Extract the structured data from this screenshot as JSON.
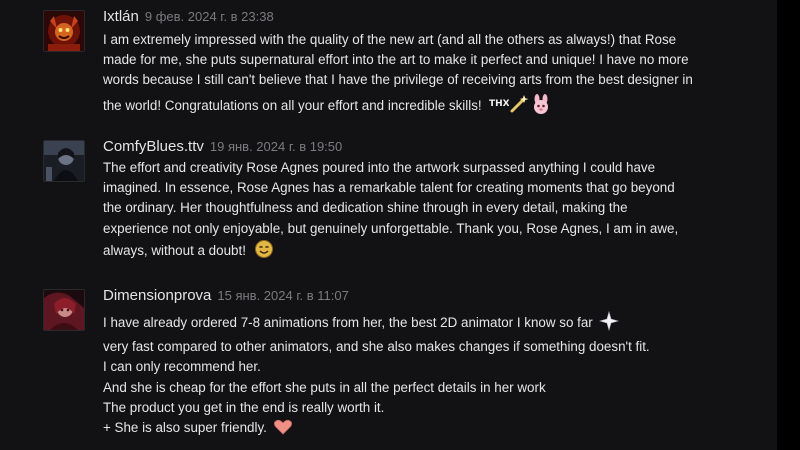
{
  "comments": [
    {
      "author": "Ixtlán",
      "date": "9 фев. 2024 г. в 23:38",
      "lines": [
        "I am extremely impressed with the quality of the new art (and all the others as always!) that Rose",
        "made for me, she puts supernatural effort into the art to make it perfect and unique! I have no more",
        "words because I still can't believe that I have the privilege of receiving arts from the best designer in",
        "the world! Congratulations on all your effort and incredible skills!"
      ],
      "emoji_text": "THX",
      "emoticons": [
        "thx-emoticon",
        "magic-wand-emoticon",
        "pink-bunny-emoticon"
      ]
    },
    {
      "author": "ComfyBlues.ttv",
      "date": "19 янв. 2024 г. в 19:50",
      "lines": [
        "The effort and creativity Rose Agnes poured into the artwork surpassed anything I could have",
        "imagined. In essence, Rose Agnes has a remarkable talent for creating moments that go beyond",
        "the ordinary. Her thoughtfulness and dedication shine through in every detail, making the",
        "experience not only enjoyable, but genuinely unforgettable. Thank you, Rose Agnes, I am in awe,",
        "always, without a doubt!"
      ],
      "emoticons": [
        "smiling-face-emoticon"
      ]
    },
    {
      "author": "Dimensionprova",
      "date": "15 янв. 2024 г. в 11:07",
      "lines": [
        "I have already ordered 7-8 animations from her, the best 2D animator I know so far",
        "very fast compared to other animators, and she also makes changes if something doesn't fit.",
        "I can only recommend her.",
        "And she is cheap for the effort she puts in all the perfect details in her work",
        "The product you get in the end is really worth it.",
        "+ She is also super friendly."
      ],
      "emoticons": [
        "sparkle-emoticon",
        "heart-emoticon"
      ]
    }
  ],
  "colors": {
    "panel_bg": "#121214",
    "page_bg": "#000000",
    "author": "#e4e4e6",
    "date": "#7b7b80",
    "text": "#e6e6e8"
  }
}
